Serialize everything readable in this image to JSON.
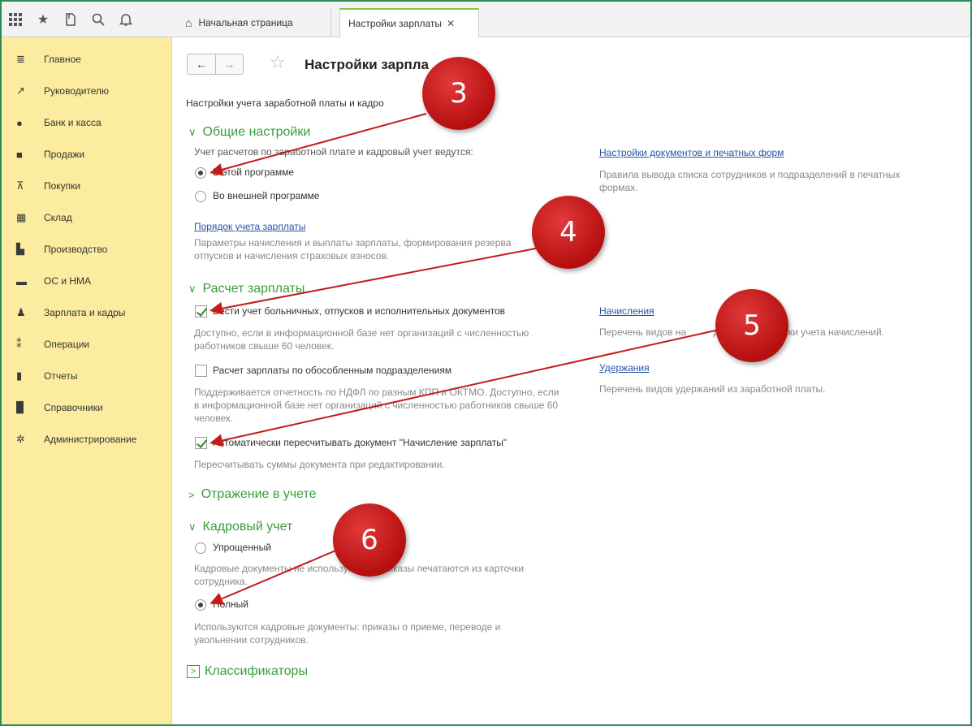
{
  "tabs": {
    "home": "Начальная страница",
    "active": "Настройки зарплаты",
    "close": "✕"
  },
  "sidebar": {
    "items": [
      {
        "label": "Главное",
        "icon": "menu-icon"
      },
      {
        "label": "Руководителю",
        "icon": "trend-icon"
      },
      {
        "label": "Банк и касса",
        "icon": "coin-icon"
      },
      {
        "label": "Продажи",
        "icon": "bag-icon"
      },
      {
        "label": "Покупки",
        "icon": "cart-icon"
      },
      {
        "label": "Склад",
        "icon": "warehouse-icon"
      },
      {
        "label": "Производство",
        "icon": "factory-icon"
      },
      {
        "label": "ОС и НМА",
        "icon": "truck-icon"
      },
      {
        "label": "Зарплата и кадры",
        "icon": "person-icon"
      },
      {
        "label": "Операции",
        "icon": "operations-icon"
      },
      {
        "label": "Отчеты",
        "icon": "chart-icon"
      },
      {
        "label": "Справочники",
        "icon": "book-icon"
      },
      {
        "label": "Администрирование",
        "icon": "gear-icon"
      }
    ]
  },
  "page": {
    "title": "Настройки зарпла",
    "subtitle": "Настройки учета заработной платы и кадро"
  },
  "general": {
    "header": "Общие настройки",
    "question": "Учет расчетов по заработной плате и кадровый учет ведутся:",
    "opt_this": "В этой программе",
    "opt_external": "Во внешней программе",
    "order_link": "Порядок учета зарплаты",
    "order_hint": "Параметры начисления и выплаты зарплаты, формирования резерва отпусков и начисления страховых взносов.",
    "docs_link": "Настройки документов и печатных форм",
    "docs_hint": "Правила вывода списка сотрудников и подразделений в печатных формах."
  },
  "payroll": {
    "header": "Расчет зарплаты",
    "chk1": "Вести учет больничных, отпусков и исполнительных документов",
    "chk1_hint": "Доступно, если в информационной базе нет организаций с численностью работников свыше 60 человек.",
    "chk2": "Расчет зарплаты по обособленным подразделениям",
    "chk2_hint": "Поддерживается отчетность по НДФЛ по разным КПП и ОКТМО. Доступно, если в информационной базе нет организаций с численностью работников свыше 60 человек.",
    "chk3": "Автоматически пересчитывать документ \"Начисление зарплаты\"",
    "chk3_hint": "Пересчитывать суммы документа при редактировании.",
    "accruals_link": "Начисления",
    "accruals_hint": "Перечень видов на          дникам, настройки учета начислений.",
    "deductions_link": "Удержания",
    "deductions_hint": "Перечень видов удержаний из заработной платы."
  },
  "accounting": {
    "header": "Отражение в учете"
  },
  "hr": {
    "header": "Кадровый учет",
    "opt_simple": "Упрощенный",
    "simple_hint": "Кадровые документы не используются. Приказы печатаются из карточки сотрудника.",
    "opt_full": "Полный",
    "full_hint": "Используются кадровые документы: приказы о приеме, переводе и увольнении сотрудников."
  },
  "classifiers": {
    "header": "Классификаторы"
  },
  "annotations": {
    "b3": "3",
    "b4": "4",
    "b5": "5",
    "b6": "6",
    "color": "#c41a1a"
  }
}
